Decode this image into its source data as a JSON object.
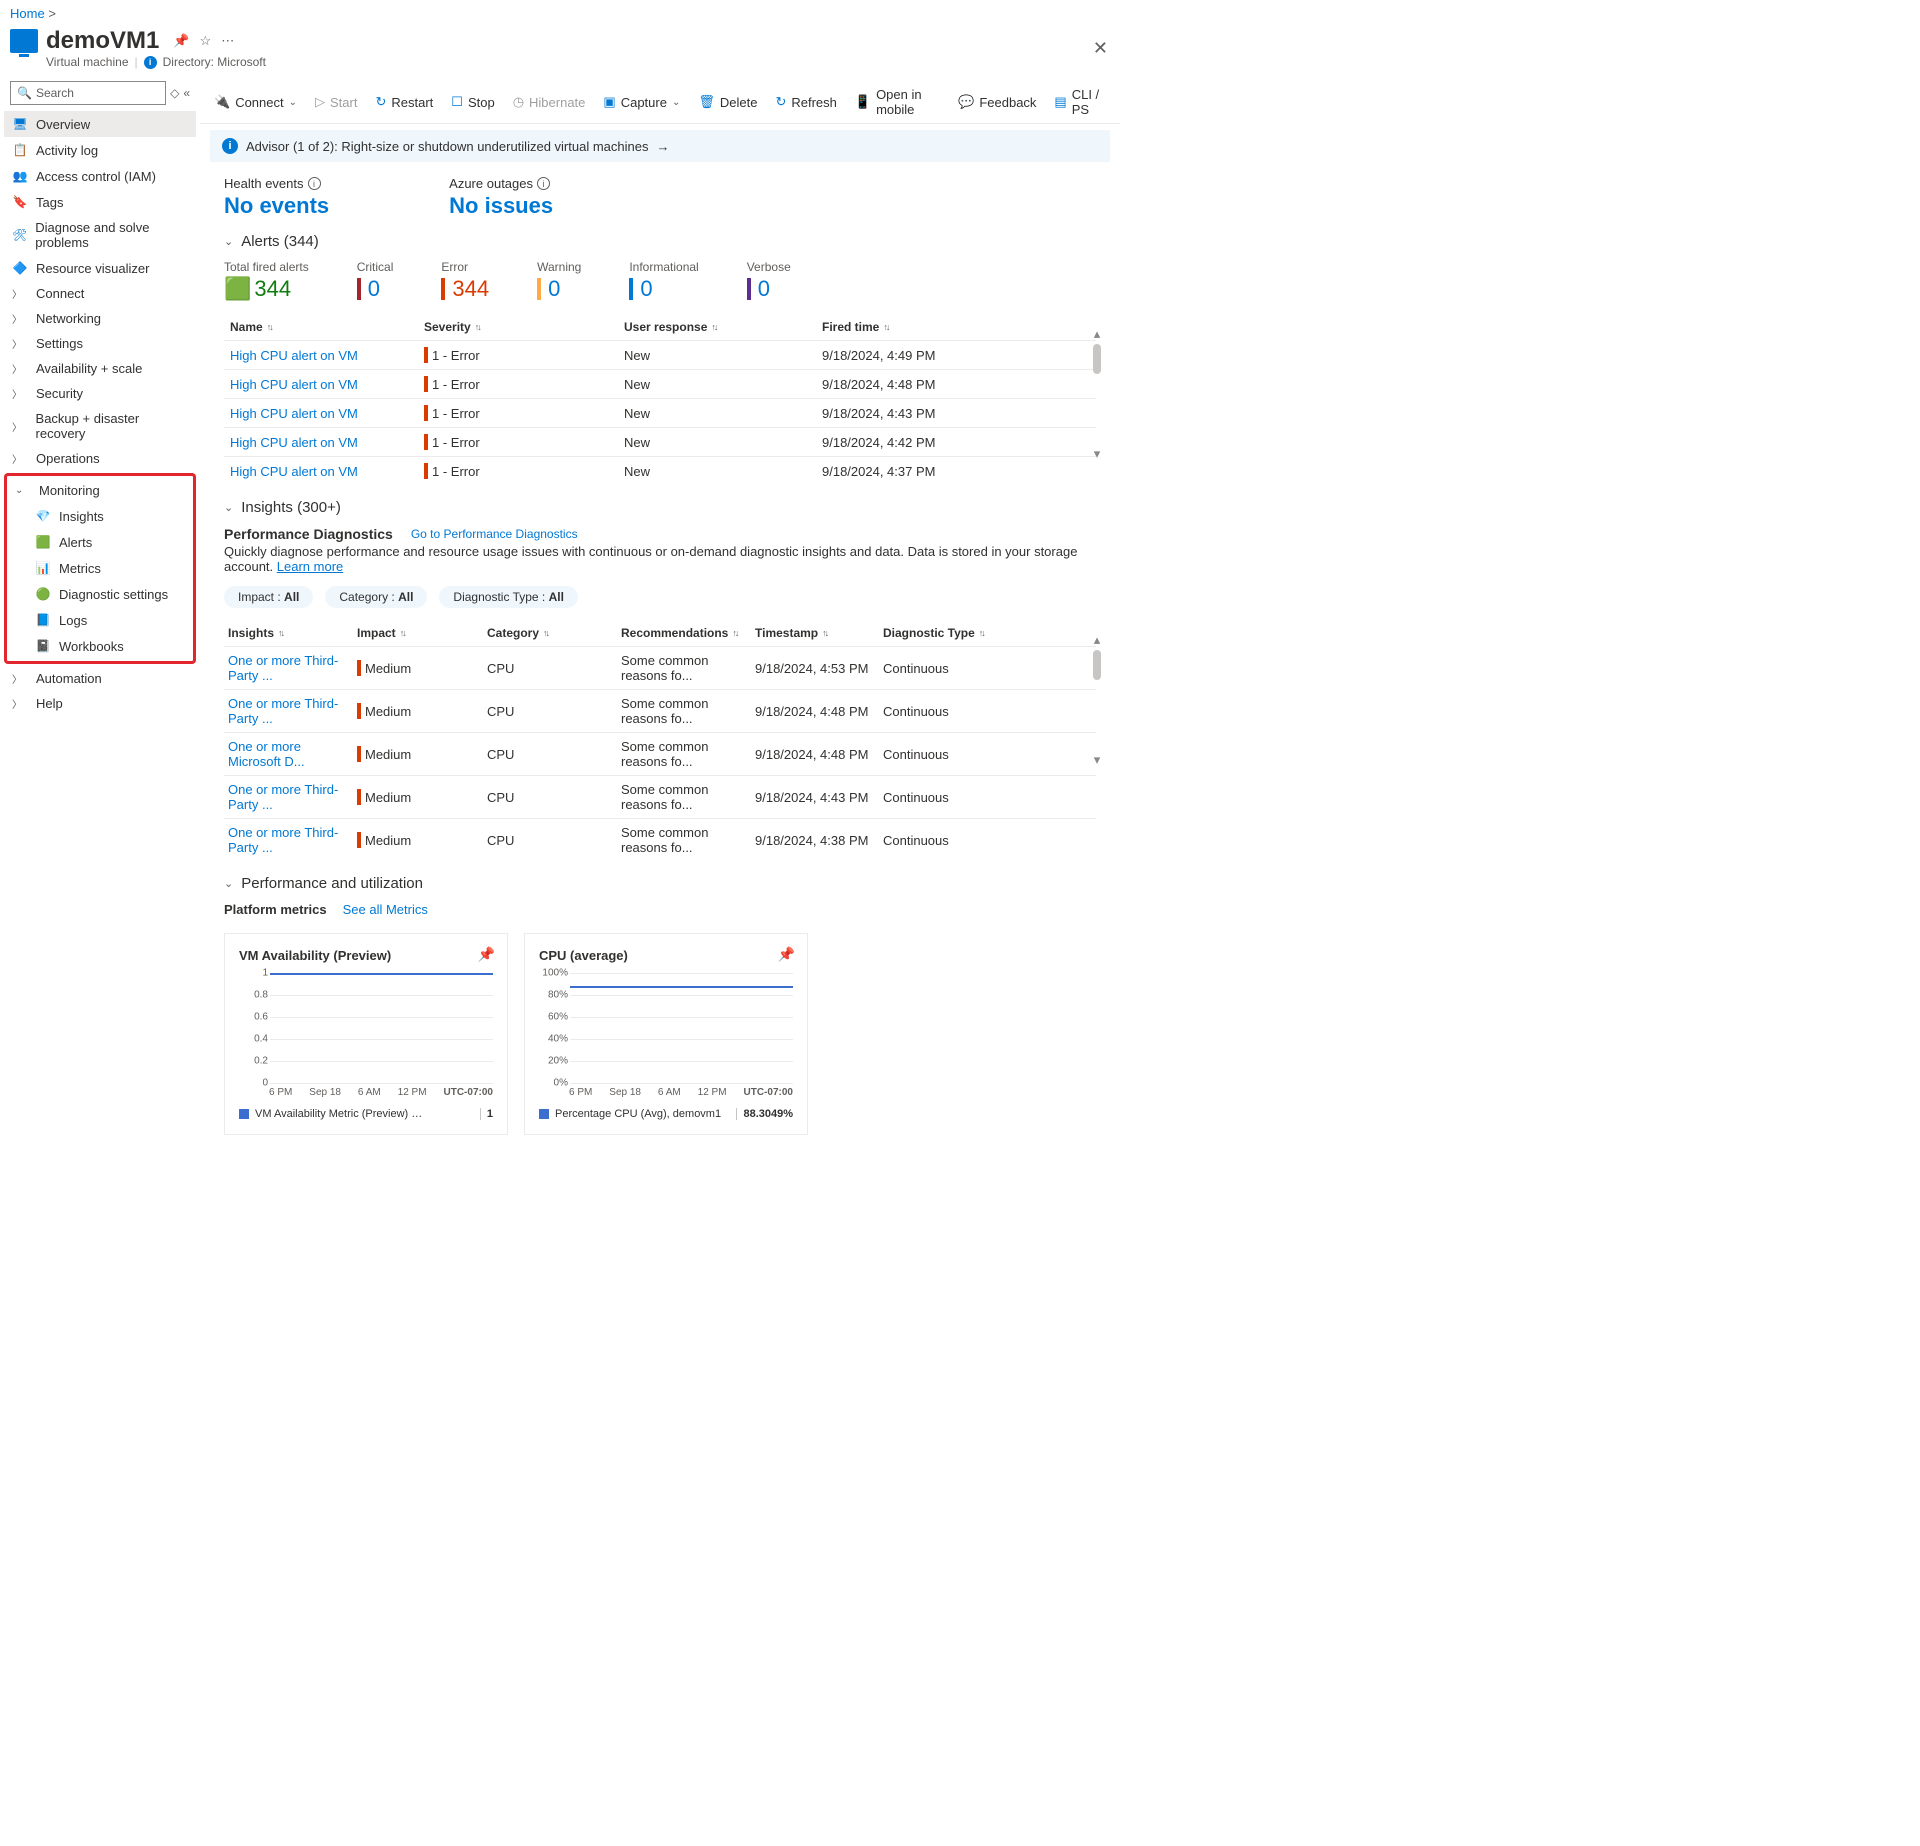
{
  "breadcrumb": {
    "home": "Home"
  },
  "header": {
    "title": "demoVM1",
    "subtitle_type": "Virtual machine",
    "directory": "Directory: Microsoft"
  },
  "search": {
    "placeholder": "Search"
  },
  "sidebar": {
    "overview": "Overview",
    "activity": "Activity log",
    "iam": "Access control (IAM)",
    "tags": "Tags",
    "diagnose": "Diagnose and solve problems",
    "resviz": "Resource visualizer",
    "connect": "Connect",
    "networking": "Networking",
    "settings": "Settings",
    "avail": "Availability + scale",
    "security": "Security",
    "backup": "Backup + disaster recovery",
    "operations": "Operations",
    "monitoring": "Monitoring",
    "insights": "Insights",
    "alerts": "Alerts",
    "metrics": "Metrics",
    "diagset": "Diagnostic settings",
    "logs": "Logs",
    "workbooks": "Workbooks",
    "automation": "Automation",
    "help": "Help"
  },
  "toolbar": {
    "connect": "Connect",
    "start": "Start",
    "restart": "Restart",
    "stop": "Stop",
    "hibernate": "Hibernate",
    "capture": "Capture",
    "delete": "Delete",
    "refresh": "Refresh",
    "openmobile": "Open in mobile",
    "feedback": "Feedback",
    "cli": "CLI / PS"
  },
  "advisor": "Advisor (1 of 2): Right-size or shutdown underutilized virtual machines",
  "health": {
    "events_label": "Health events",
    "events_value": "No events",
    "outages_label": "Azure outages",
    "outages_value": "No issues"
  },
  "alerts": {
    "header": "Alerts (344)",
    "stats": {
      "total_label": "Total fired alerts",
      "total_value": "344",
      "critical_label": "Critical",
      "critical_value": "0",
      "error_label": "Error",
      "error_value": "344",
      "warning_label": "Warning",
      "warning_value": "0",
      "info_label": "Informational",
      "info_value": "0",
      "verbose_label": "Verbose",
      "verbose_value": "0"
    },
    "columns": {
      "name": "Name",
      "severity": "Severity",
      "response": "User response",
      "fired": "Fired time"
    },
    "rows": [
      {
        "name": "High CPU alert on VM",
        "sev": "1 - Error",
        "resp": "New",
        "time": "9/18/2024, 4:49 PM"
      },
      {
        "name": "High CPU alert on VM",
        "sev": "1 - Error",
        "resp": "New",
        "time": "9/18/2024, 4:48 PM"
      },
      {
        "name": "High CPU alert on VM",
        "sev": "1 - Error",
        "resp": "New",
        "time": "9/18/2024, 4:43 PM"
      },
      {
        "name": "High CPU alert on VM",
        "sev": "1 - Error",
        "resp": "New",
        "time": "9/18/2024, 4:42 PM"
      },
      {
        "name": "High CPU alert on VM",
        "sev": "1 - Error",
        "resp": "New",
        "time": "9/18/2024, 4:37 PM"
      }
    ]
  },
  "insights_section": {
    "header": "Insights (300+)",
    "perf_title": "Performance Diagnostics",
    "perf_link": "Go to Performance Diagnostics",
    "perf_desc": "Quickly diagnose performance and resource usage issues with continuous or on-demand diagnostic insights and data. Data is stored in your storage account.",
    "learn_more": "Learn more",
    "chips": {
      "impact": "Impact :",
      "impact_v": "All",
      "category": "Category :",
      "category_v": "All",
      "dtype": "Diagnostic Type :",
      "dtype_v": "All"
    },
    "columns": {
      "insights": "Insights",
      "impact": "Impact",
      "category": "Category",
      "rec": "Recommendations",
      "ts": "Timestamp",
      "dt": "Diagnostic Type"
    },
    "rows": [
      {
        "ins": "One or more Third-Party ...",
        "imp": "Medium",
        "cat": "CPU",
        "rec": "Some common reasons fo...",
        "ts": "9/18/2024, 4:53 PM",
        "dt": "Continuous"
      },
      {
        "ins": "One or more Third-Party ...",
        "imp": "Medium",
        "cat": "CPU",
        "rec": "Some common reasons fo...",
        "ts": "9/18/2024, 4:48 PM",
        "dt": "Continuous"
      },
      {
        "ins": "One or more Microsoft D...",
        "imp": "Medium",
        "cat": "CPU",
        "rec": "Some common reasons fo...",
        "ts": "9/18/2024, 4:48 PM",
        "dt": "Continuous"
      },
      {
        "ins": "One or more Third-Party ...",
        "imp": "Medium",
        "cat": "CPU",
        "rec": "Some common reasons fo...",
        "ts": "9/18/2024, 4:43 PM",
        "dt": "Continuous"
      },
      {
        "ins": "One or more Third-Party ...",
        "imp": "Medium",
        "cat": "CPU",
        "rec": "Some common reasons fo...",
        "ts": "9/18/2024, 4:38 PM",
        "dt": "Continuous"
      }
    ]
  },
  "perfutil": {
    "header": "Performance and utilization",
    "platform": "Platform metrics",
    "seeall": "See all Metrics"
  },
  "chart_data": [
    {
      "type": "line",
      "title": "VM Availability (Preview)",
      "y_ticks": [
        "1",
        "0.8",
        "0.6",
        "0.4",
        "0.2",
        "0"
      ],
      "x_ticks": [
        "6 PM",
        "Sep 18",
        "6 AM",
        "12 PM"
      ],
      "tz": "UTC-07:00",
      "series": [
        {
          "name": "VM Availability Metric (Preview) (Min), de...",
          "value_label": "1",
          "flat_y": 1
        }
      ],
      "ylim": [
        0,
        1
      ]
    },
    {
      "type": "line",
      "title": "CPU (average)",
      "y_ticks": [
        "100%",
        "80%",
        "60%",
        "40%",
        "20%",
        "0%"
      ],
      "x_ticks": [
        "6 PM",
        "Sep 18",
        "6 AM",
        "12 PM"
      ],
      "tz": "UTC-07:00",
      "series": [
        {
          "name": "Percentage CPU (Avg), demovm1",
          "value_label": "88.3049%",
          "flat_y": 88
        }
      ],
      "ylim": [
        0,
        100
      ]
    }
  ],
  "colors": {
    "error": "#da3b01",
    "critical": "#a4262c",
    "warning": "#ffaa44",
    "info": "#0078d4",
    "verbose": "#5c2e91",
    "total": "#107c10"
  }
}
